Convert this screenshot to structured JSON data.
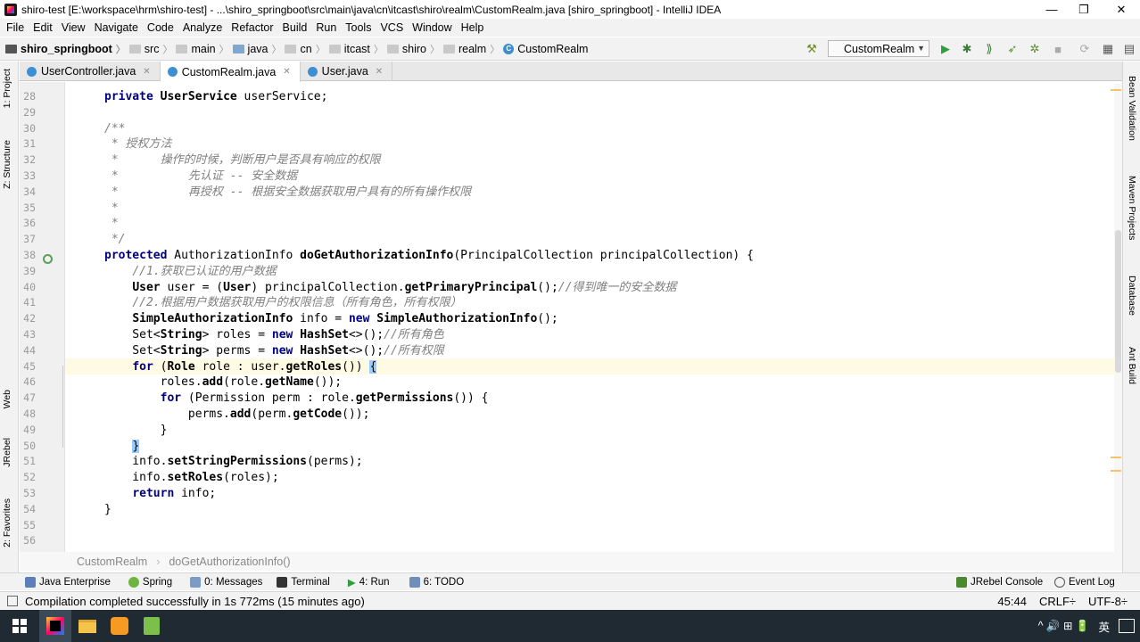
{
  "window": {
    "title": "shiro-test [E:\\workspace\\hrm\\shiro-test] - ...\\shiro_springboot\\src\\main\\java\\cn\\itcast\\shiro\\realm\\CustomRealm.java [shiro_springboot] - IntelliJ IDEA",
    "minimize": "—",
    "maximize": "❐",
    "close": "✕"
  },
  "menu": [
    "File",
    "Edit",
    "View",
    "Navigate",
    "Code",
    "Analyze",
    "Refactor",
    "Build",
    "Run",
    "Tools",
    "VCS",
    "Window",
    "Help"
  ],
  "breadcrumbs": [
    "shiro_springboot",
    "src",
    "main",
    "java",
    "cn",
    "itcast",
    "shiro",
    "realm",
    "CustomRealm"
  ],
  "run_config": "CustomRealm",
  "left_tabs": [
    "1: Project",
    "Z: Structure",
    "Web",
    "JRebel",
    "2: Favorites"
  ],
  "right_tabs": [
    "Bean Validation",
    "Maven Projects",
    "Database",
    "Ant Build"
  ],
  "editor_tabs": [
    {
      "label": "UserController.java",
      "active": false
    },
    {
      "label": "CustomRealm.java",
      "active": true
    },
    {
      "label": "User.java",
      "active": false
    }
  ],
  "lines": [
    {
      "n": "28",
      "html": "<span class=\"kw\">private</span> <span class=\"fn\">UserService</span> userService;"
    },
    {
      "n": "29",
      "html": ""
    },
    {
      "n": "30",
      "html": "<span class=\"cm\">/**</span>"
    },
    {
      "n": "31",
      "html": "<span class=\"cm\"> * 授权方法</span>"
    },
    {
      "n": "32",
      "html": "<span class=\"cm\"> *      操作的时候，判断用户是否具有响应的权限</span>"
    },
    {
      "n": "33",
      "html": "<span class=\"cm\"> *          先认证 -- 安全数据</span>"
    },
    {
      "n": "34",
      "html": "<span class=\"cm\"> *          再授权 -- 根据安全数据获取用户具有的所有操作权限</span>"
    },
    {
      "n": "35",
      "html": "<span class=\"cm\"> *</span>"
    },
    {
      "n": "36",
      "html": "<span class=\"cm\"> *</span>"
    },
    {
      "n": "37",
      "html": "<span class=\"cm\"> */</span>"
    },
    {
      "n": "38",
      "html": "<span class=\"kw\">protected</span> AuthorizationInfo <span class=\"fn\">doGetAuthorizationInfo</span>(PrincipalCollection principalCollection) {"
    },
    {
      "n": "39",
      "html": "    <span class=\"cm\">//1.获取已认证的用户数据</span>"
    },
    {
      "n": "40",
      "html": "    <span class=\"fn\">User</span> user = (<span class=\"fn\">User</span>) principalCollection.<span class=\"fn\">getPrimaryPrincipal</span>();<span class=\"cm\">//得到唯一的安全数据</span>"
    },
    {
      "n": "41",
      "html": "    <span class=\"cm\">//2.根据用户数据获取用户的权限信息（所有角色，所有权限）</span>"
    },
    {
      "n": "42",
      "html": "    <span class=\"fn\">SimpleAuthorizationInfo</span> info = <span class=\"kw\">new</span> <span class=\"fn\">SimpleAuthorizationInfo</span>();"
    },
    {
      "n": "43",
      "html": "    Set&lt;<span class=\"fn\">String</span>&gt; roles = <span class=\"kw\">new</span> <span class=\"fn\">HashSet</span>&lt;&gt;();<span class=\"cm\">//所有角色</span>"
    },
    {
      "n": "44",
      "html": "    Set&lt;<span class=\"fn\">String</span>&gt; perms = <span class=\"kw\">new</span> <span class=\"fn\">HashSet</span>&lt;&gt;();<span class=\"cm\">//所有权限</span>"
    },
    {
      "n": "45",
      "html": "    <span class=\"kw\">for</span> (<span class=\"fn\">Role</span> role : user.<span class=\"fn\">getRoles</span>()) <span class=\"brace-hl\">{</span>"
    },
    {
      "n": "46",
      "html": "        roles.<span class=\"fn\">add</span>(role.<span class=\"fn\">getName</span>());"
    },
    {
      "n": "47",
      "html": "        <span class=\"kw\">for</span> (Permission perm : role.<span class=\"fn\">getPermissions</span>()) {"
    },
    {
      "n": "48",
      "html": "            perms.<span class=\"fn\">add</span>(perm.<span class=\"fn\">getCode</span>());"
    },
    {
      "n": "49",
      "html": "        }"
    },
    {
      "n": "50",
      "html": "    <span class=\"brace-hl\">}</span>"
    },
    {
      "n": "51",
      "html": "    info.<span class=\"fn\">setStringPermissions</span>(perms);"
    },
    {
      "n": "52",
      "html": "    info.<span class=\"fn\">setRoles</span>(roles);"
    },
    {
      "n": "53",
      "html": "    <span class=\"kw\">return</span> info;"
    },
    {
      "n": "54",
      "html": "}"
    },
    {
      "n": "55",
      "html": ""
    },
    {
      "n": "56",
      "html": ""
    }
  ],
  "footer_breadcrumb": [
    "CustomRealm",
    "doGetAuthorizationInfo()"
  ],
  "tool_windows_left": [
    "Java Enterprise",
    "Spring",
    "0: Messages",
    "Terminal",
    "4: Run",
    "6: TODO"
  ],
  "tool_windows_right": [
    "JRebel Console",
    "Event Log"
  ],
  "status": {
    "message": "Compilation completed successfully in 1s 772ms (15 minutes ago)",
    "position": "45:44",
    "line_sep": "CRLF÷",
    "encoding": "UTF-8÷"
  },
  "taskbar": {
    "ime": "英",
    "tray_icons": "^ 🔊 ⊞ 🔋"
  },
  "colors": {
    "keyword": "#000080",
    "comment": "#808080",
    "caret_line": "#fffae3",
    "brace_match": "#99ccff"
  }
}
